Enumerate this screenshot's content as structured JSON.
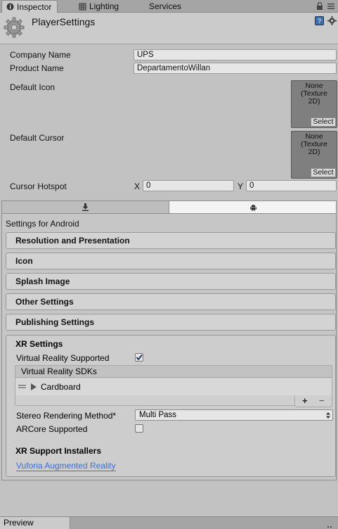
{
  "tabs": [
    {
      "label": "Inspector",
      "icon": "info-icon",
      "active": true
    },
    {
      "label": "Lighting",
      "icon": "lighting-icon",
      "active": false
    },
    {
      "label": "Services",
      "icon": "",
      "active": false
    }
  ],
  "header": {
    "title": "PlayerSettings",
    "icon": "gear-icon"
  },
  "fields": {
    "company_label": "Company Name",
    "company_value": "UPS",
    "product_label": "Product Name",
    "product_value": "DepartamentoWillan",
    "default_icon_label": "Default Icon",
    "default_cursor_label": "Default Cursor",
    "texture_none": "None",
    "texture_type": "(Texture",
    "texture_2d": "2D)",
    "select_label": "Select",
    "hotspot_label": "Cursor Hotspot",
    "hotspot_x_label": "X",
    "hotspot_x_value": "0",
    "hotspot_y_label": "Y",
    "hotspot_y_value": "0"
  },
  "platform": {
    "tabs": [
      "standalone-download-icon",
      "android-icon"
    ],
    "active": 1,
    "settings_title": "Settings for Android"
  },
  "sections": [
    "Resolution and Presentation",
    "Icon",
    "Splash Image",
    "Other Settings",
    "Publishing Settings"
  ],
  "xr": {
    "title": "XR Settings",
    "vr_supported_label": "Virtual Reality Supported",
    "vr_supported_checked": true,
    "sdks_header": "Virtual Reality SDKs",
    "sdks": [
      "Cardboard"
    ],
    "add_label": "+",
    "remove_label": "−",
    "stereo_label": "Stereo Rendering Method*",
    "stereo_value": "Multi Pass",
    "arcore_label": "ARCore Supported",
    "arcore_checked": false,
    "installers_title": "XR Support Installers",
    "installer_link": "Vuforia Augmented Reality"
  },
  "bottom": {
    "preview_label": "Preview"
  },
  "colors": {
    "link": "#3a6fd8",
    "check": "#233a66"
  }
}
